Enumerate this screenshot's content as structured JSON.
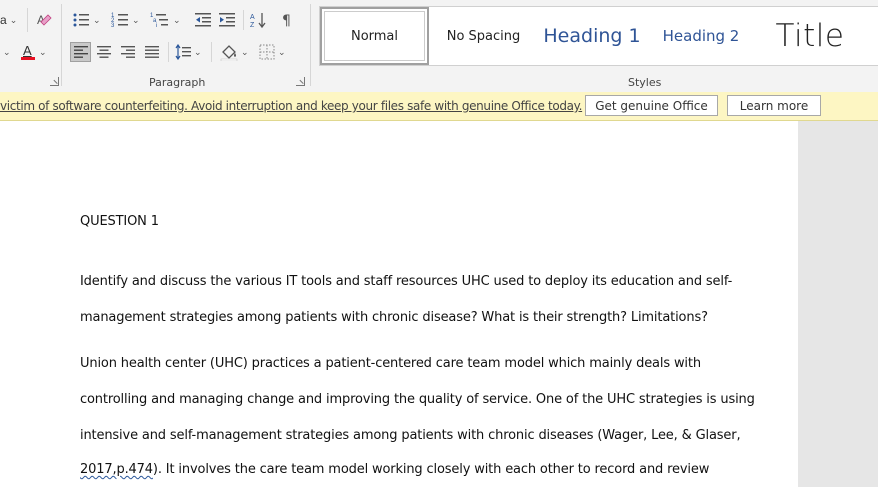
{
  "ribbon": {
    "font_group": {
      "font_size_fragment": "a",
      "font_color": "#e81123"
    },
    "paragraph_group": {
      "label": "Paragraph"
    },
    "styles_group": {
      "label": "Styles",
      "items": [
        {
          "label": "Normal",
          "selected": true
        },
        {
          "label": "No Spacing"
        },
        {
          "label": "Heading 1",
          "color": "#2f5496"
        },
        {
          "label": "Heading 2",
          "color": "#2f5496"
        },
        {
          "label": "Title"
        }
      ]
    }
  },
  "banner": {
    "message": "victim of software counterfeiting. Avoid interruption and keep your files safe with genuine Office today.",
    "get_genuine_label": "Get genuine Office",
    "learn_more_label": "Learn more"
  },
  "document": {
    "heading": "QUESTION 1",
    "question_lines": [
      "Identify and discuss the various IT tools and staff resources UHC used to deploy its education and self-",
      "management strategies among patients with chronic disease? What is their strength? Limitations?"
    ],
    "answer_lines": [
      "Union health center (UHC) practices a patient-centered care team model which mainly deals with",
      "controlling and managing change and improving the quality of service. One of the UHC strategies is using",
      "intensive and self-management strategies among patients with chronic diseases (Wager, Lee, & Glaser,"
    ],
    "last_line_flagged": "2017,p.474",
    "last_line_rest": "). It involves the care team model working closely with each other to record and review"
  }
}
